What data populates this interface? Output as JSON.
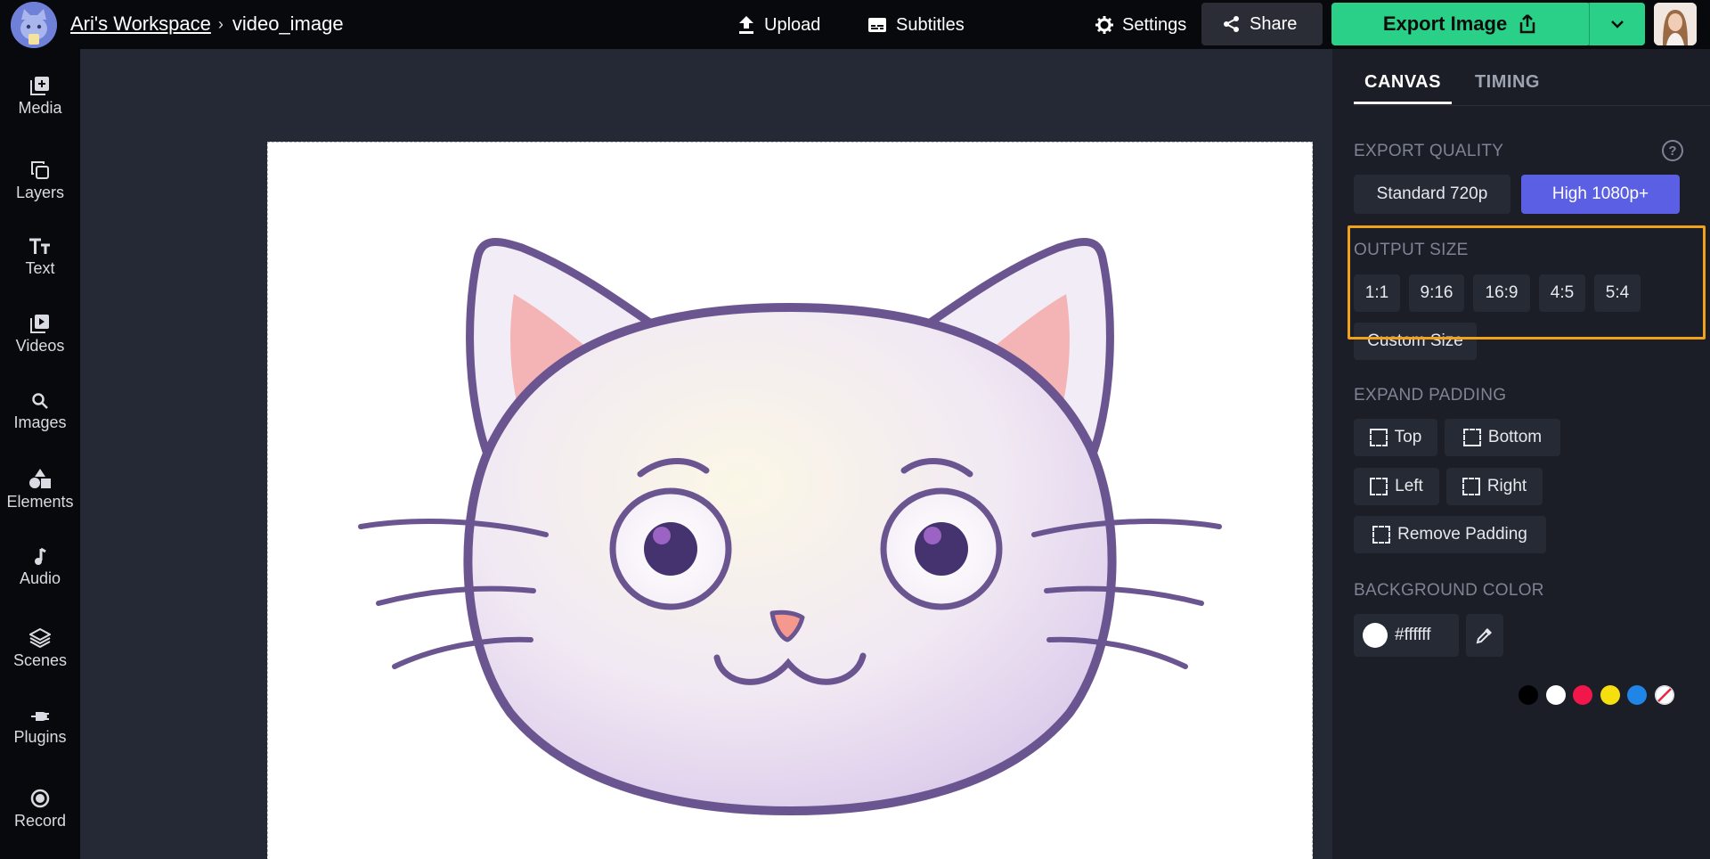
{
  "topbar": {
    "workspace": "Ari's Workspace",
    "project": "video_image",
    "upload": "Upload",
    "subtitles": "Subtitles",
    "settings": "Settings",
    "share": "Share",
    "export": "Export Image"
  },
  "rail": {
    "items": [
      "Media",
      "Layers",
      "Text",
      "Videos",
      "Images",
      "Elements",
      "Audio",
      "Scenes",
      "Plugins",
      "Record"
    ]
  },
  "panel": {
    "tabs": [
      "CANVAS",
      "TIMING"
    ],
    "export_quality": {
      "label": "EXPORT QUALITY",
      "help": "?",
      "options": [
        "Standard 720p",
        "High 1080p+"
      ],
      "selected": "High 1080p+"
    },
    "output_size": {
      "label": "OUTPUT SIZE",
      "options": [
        "1:1",
        "9:16",
        "16:9",
        "4:5",
        "5:4"
      ],
      "custom": "Custom Size"
    },
    "expand_padding": {
      "label": "EXPAND PADDING",
      "top": "Top",
      "bottom": "Bottom",
      "left": "Left",
      "right": "Right",
      "remove": "Remove Padding"
    },
    "background_color": {
      "label": "BACKGROUND COLOR",
      "value": "#ffffff",
      "presets": [
        "#000000",
        "#ffffff",
        "#f2174a",
        "#f5df0f",
        "#1f86e8",
        "none"
      ]
    }
  },
  "colors": {
    "accent_export": "#2bd088",
    "accent_selected": "#5b5fe3",
    "highlight": "#f2a21a"
  }
}
